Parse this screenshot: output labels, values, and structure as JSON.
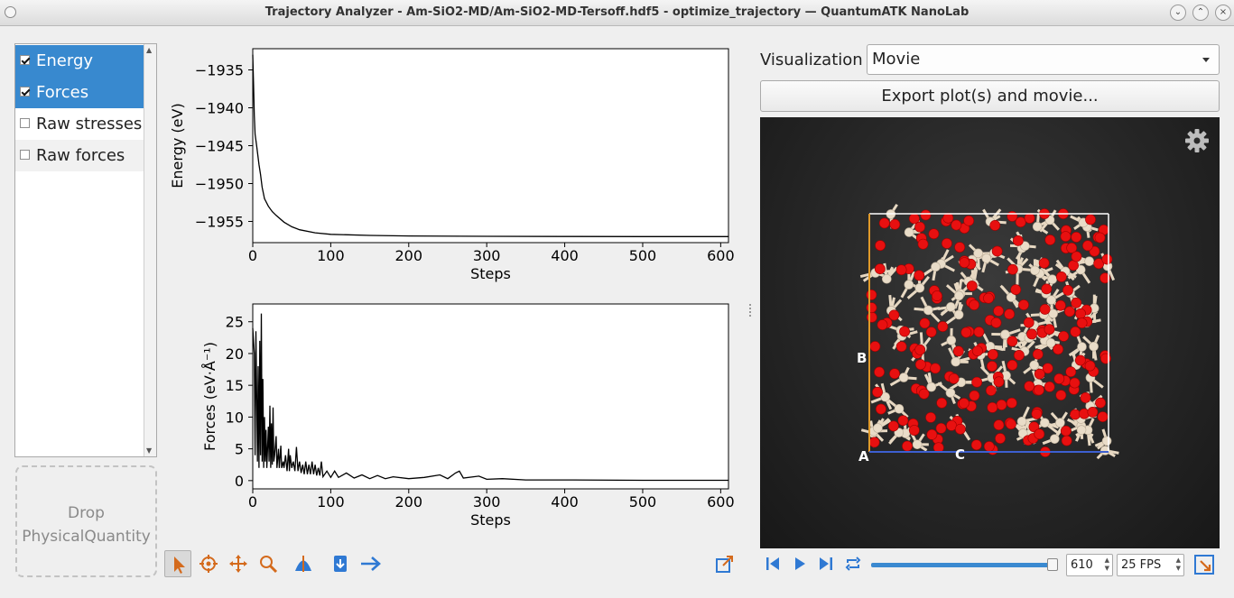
{
  "window": {
    "title": "Trajectory Analyzer - Am-SiO2-MD/Am-SiO2-MD-Tersoff.hdf5 - optimize_trajectory — QuantumATK NanoLab"
  },
  "quantities": {
    "items": [
      {
        "label": "Energy",
        "checked": true,
        "selected": true
      },
      {
        "label": "Forces",
        "checked": true,
        "selected": true
      },
      {
        "label": "Raw stresses",
        "checked": false,
        "selected": false
      },
      {
        "label": "Raw forces",
        "checked": false,
        "selected": false
      }
    ],
    "drop_label": "Drop PhysicalQuantity"
  },
  "chart_data": [
    {
      "type": "line",
      "xlabel": "Steps",
      "ylabel": "Energy (eV)",
      "xlim": [
        0,
        610
      ],
      "ylim": [
        -1957.8,
        -1932.2
      ],
      "xticks": [
        0,
        100,
        200,
        300,
        400,
        500,
        600
      ],
      "yticks": [
        -1935,
        -1940,
        -1945,
        -1950,
        -1955
      ],
      "series": [
        {
          "values": [
            [
              0,
              -1933
            ],
            [
              1,
              -1937
            ],
            [
              2,
              -1941
            ],
            [
              3,
              -1943.5
            ],
            [
              5,
              -1945
            ],
            [
              8,
              -1947.5
            ],
            [
              10,
              -1948.8
            ],
            [
              12,
              -1950.5
            ],
            [
              15,
              -1952
            ],
            [
              20,
              -1953
            ],
            [
              25,
              -1953.7
            ],
            [
              30,
              -1954.2
            ],
            [
              40,
              -1955.1
            ],
            [
              50,
              -1955.7
            ],
            [
              60,
              -1956.1
            ],
            [
              80,
              -1956.5
            ],
            [
              100,
              -1956.7
            ],
            [
              150,
              -1956.85
            ],
            [
              200,
              -1956.92
            ],
            [
              300,
              -1956.97
            ],
            [
              400,
              -1956.99
            ],
            [
              500,
              -1957
            ],
            [
              610,
              -1957
            ]
          ]
        }
      ]
    },
    {
      "type": "line",
      "xlabel": "Steps",
      "ylabel": "Forces (eV·Å⁻¹)",
      "xlim": [
        0,
        610
      ],
      "ylim": [
        -1.3,
        27.8
      ],
      "xticks": [
        0,
        100,
        200,
        300,
        400,
        500,
        600
      ],
      "yticks": [
        0,
        5,
        10,
        15,
        20,
        25
      ],
      "series": [
        {
          "values": [
            [
              0,
              24
            ],
            [
              2,
              20
            ],
            [
              3,
              4
            ],
            [
              4,
              23.5
            ],
            [
              6,
              3
            ],
            [
              7,
              18
            ],
            [
              8,
              2
            ],
            [
              9,
              22
            ],
            [
              10,
              4
            ],
            [
              11,
              26.3
            ],
            [
              12,
              3
            ],
            [
              13,
              16
            ],
            [
              14,
              2
            ],
            [
              15,
              10
            ],
            [
              16,
              3
            ],
            [
              17,
              8
            ],
            [
              18,
              2
            ],
            [
              20,
              8.5
            ],
            [
              21,
              3
            ],
            [
              22,
              11.8
            ],
            [
              23,
              2
            ],
            [
              24,
              9
            ],
            [
              25,
              2.5
            ],
            [
              26,
              11.5
            ],
            [
              27,
              3
            ],
            [
              28,
              4
            ],
            [
              30,
              7
            ],
            [
              31,
              2
            ],
            [
              33,
              5
            ],
            [
              34,
              2
            ],
            [
              36,
              5.5
            ],
            [
              37,
              2
            ],
            [
              39,
              3
            ],
            [
              40,
              2
            ],
            [
              42,
              4
            ],
            [
              44,
              1.5
            ],
            [
              46,
              5
            ],
            [
              47,
              1.5
            ],
            [
              48,
              4
            ],
            [
              50,
              2
            ],
            [
              52,
              3
            ],
            [
              54,
              1.5
            ],
            [
              56,
              5.3
            ],
            [
              58,
              1.5
            ],
            [
              60,
              3
            ],
            [
              62,
              1.2
            ],
            [
              64,
              2.5
            ],
            [
              66,
              1
            ],
            [
              68,
              3
            ],
            [
              70,
              1
            ],
            [
              72,
              2.5
            ],
            [
              74,
              1
            ],
            [
              76,
              3
            ],
            [
              78,
              1
            ],
            [
              80,
              2.5
            ],
            [
              82,
              0.8
            ],
            [
              84,
              2
            ],
            [
              86,
              0.8
            ],
            [
              88,
              3
            ],
            [
              90,
              0.6
            ],
            [
              95,
              1.5
            ],
            [
              100,
              0.5
            ],
            [
              105,
              1.5
            ],
            [
              110,
              0.5
            ],
            [
              120,
              1.2
            ],
            [
              130,
              0.4
            ],
            [
              140,
              0.9
            ],
            [
              150,
              0.3
            ],
            [
              160,
              0.8
            ],
            [
              170,
              0.3
            ],
            [
              180,
              0.6
            ],
            [
              200,
              0.3
            ],
            [
              220,
              0.5
            ],
            [
              240,
              0.9
            ],
            [
              250,
              0.3
            ],
            [
              260,
              1.2
            ],
            [
              265,
              1.5
            ],
            [
              270,
              0.4
            ],
            [
              290,
              0.7
            ],
            [
              300,
              0.2
            ],
            [
              320,
              0.3
            ],
            [
              350,
              0.1
            ],
            [
              400,
              0.1
            ],
            [
              500,
              0.05
            ],
            [
              610,
              0.05
            ]
          ]
        }
      ]
    }
  ],
  "visualization": {
    "label": "Visualization",
    "mode": "Movie",
    "export_label": "Export plot(s) and movie...",
    "axis_labels": [
      "A",
      "B",
      "C"
    ],
    "colors": {
      "oxygen": "#e81010",
      "silicon": "#e9dcc8",
      "bond": "#e7d8c2",
      "background": "#262626"
    }
  },
  "playback": {
    "frame": "610",
    "fps": "25 FPS",
    "progress": 1.0
  },
  "colors": {
    "selection": "#3889cf",
    "accent": "#1f6fcf",
    "toolbar_orange": "#d46a1c"
  }
}
